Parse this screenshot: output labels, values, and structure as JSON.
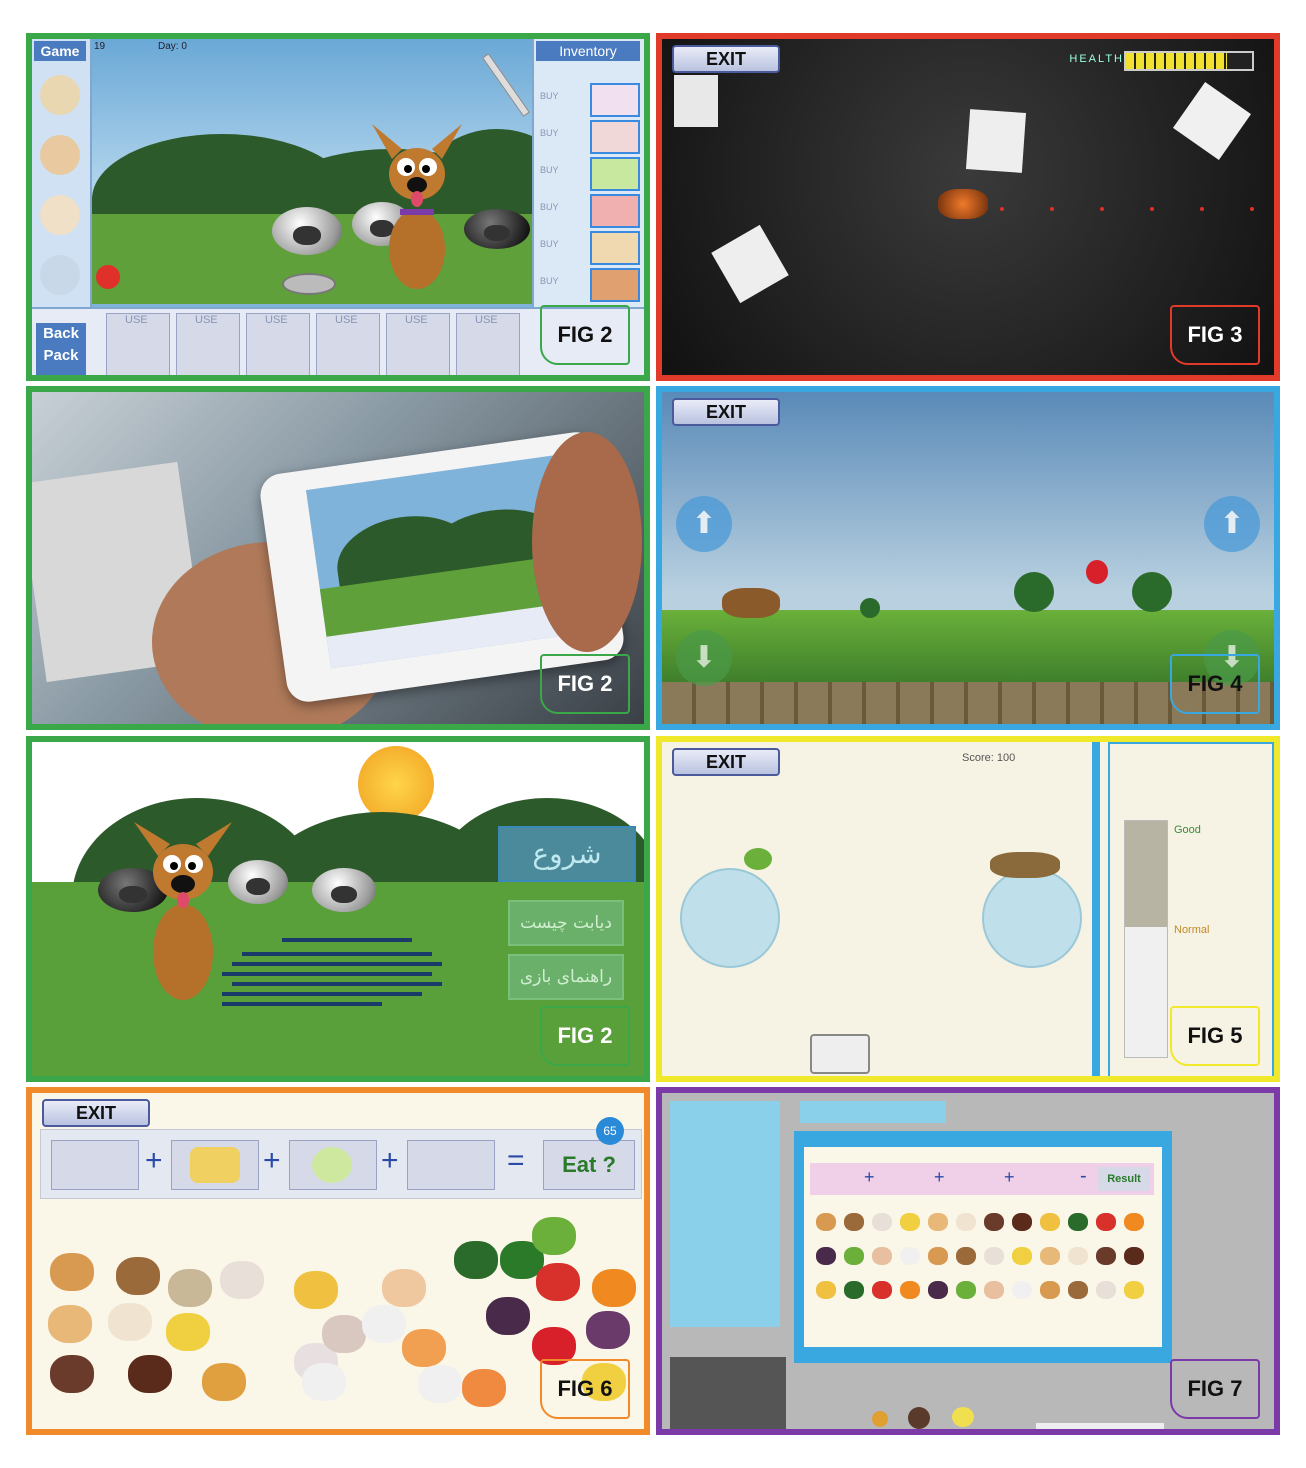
{
  "figures": {
    "p1": {
      "fig_label": "FIG 2",
      "left_tab": "Game",
      "right_tab": "Inventory",
      "day_label": "Day: 0",
      "top_number": "19",
      "buy_labels": [
        "BUY",
        "BUY",
        "BUY",
        "BUY",
        "BUY",
        "BUY"
      ],
      "use_labels": [
        "USE",
        "USE",
        "USE",
        "USE",
        "USE",
        "USE"
      ],
      "backpack_label": "Back Pack"
    },
    "p2": {
      "fig_label": "FIG 3",
      "exit_label": "EXIT",
      "health_label": "HEALTH",
      "health_value": 0.8
    },
    "p3": {
      "fig_label": "FIG 2"
    },
    "p4": {
      "fig_label": "FIG 4",
      "exit_label": "EXIT"
    },
    "p5": {
      "fig_label": "FIG 2",
      "start_button": "شروع",
      "what_is_button": "دیابت چیست",
      "guide_button": "راهنمای بازی"
    },
    "p6": {
      "fig_label": "FIG 5",
      "exit_label": "EXIT",
      "score_text": "Score: 100",
      "meter_labels": [
        "Good",
        "Normal"
      ]
    },
    "p7": {
      "fig_label": "FIG 6",
      "exit_label": "EXIT",
      "plus": "+",
      "equals": "=",
      "eat_label": "Eat ?",
      "badge": "65"
    },
    "p8": {
      "fig_label": "FIG 7",
      "plus": "+",
      "minus": "-",
      "result_label": "Result"
    }
  },
  "colors": {
    "green_border": "#3aa848",
    "red_border": "#e03a2a",
    "blue_border": "#3aa8e0",
    "yellow_border": "#f0e82a",
    "orange_border": "#f08a2a",
    "purple_border": "#7a3aa8"
  }
}
